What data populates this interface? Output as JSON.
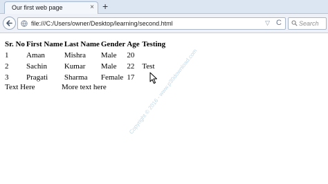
{
  "browser": {
    "tab_title": "Our first web page",
    "tab_close": "×",
    "new_tab": "+",
    "url": "file:///C:/Users/owner/Desktop/learning/second.html",
    "url_dropdown": "▽",
    "reload": "C",
    "search_placeholder": "Search"
  },
  "page": {
    "table": {
      "headers": [
        "Sr. No",
        "First Name",
        "Last Name",
        "Gender",
        "Age",
        "Testing"
      ],
      "rows": [
        [
          "1",
          "Aman",
          "Mishra",
          "Male",
          "20"
        ],
        [
          "2",
          "Sachin",
          "Kumar",
          "Male",
          "22"
        ],
        [
          "3",
          "Pragati",
          "Sharma",
          "Female",
          "17"
        ]
      ],
      "testing_value": "Test"
    },
    "text_here": "Text Here",
    "more_text": "More text here",
    "watermark": "Copyright © 2016 - www.p30download.com"
  }
}
